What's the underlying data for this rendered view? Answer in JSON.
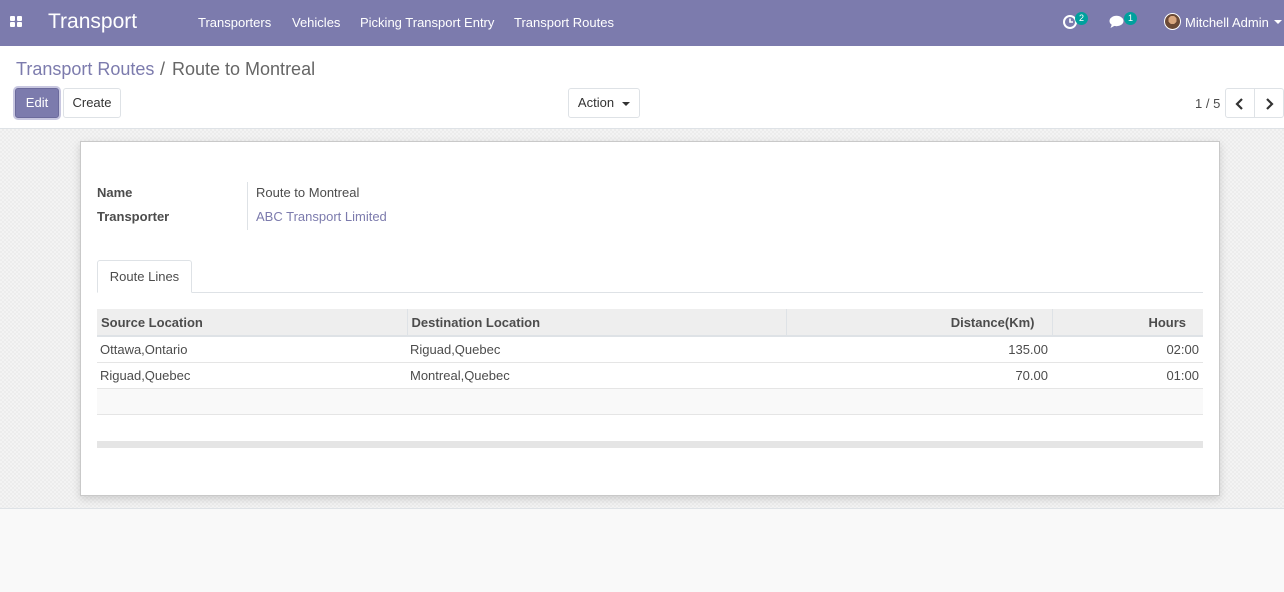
{
  "navbar": {
    "app_title": "Transport",
    "menu": [
      {
        "label": "Transporters"
      },
      {
        "label": "Vehicles"
      },
      {
        "label": "Picking Transport Entry"
      },
      {
        "label": "Transport Routes"
      }
    ],
    "activity_count": "2",
    "message_count": "1",
    "user_name": "Mitchell Admin",
    "icons": [
      "apps-grid-icon",
      "activity-clock-icon",
      "chat-bubbles-icon",
      "avatar"
    ],
    "accent_color": "#7c7bad"
  },
  "breadcrumb": {
    "parent": "Transport Routes",
    "separator": "/",
    "current": "Route to Montreal"
  },
  "toolbar": {
    "edit_label": "Edit",
    "create_label": "Create",
    "action_label": "Action"
  },
  "pager": {
    "value": "1 / 5"
  },
  "form": {
    "name_label": "Name",
    "name_value": "Route to Montreal",
    "transporter_label": "Transporter",
    "transporter_value": "ABC Transport Limited"
  },
  "tabs": [
    {
      "label": "Route Lines",
      "active": true
    }
  ],
  "route_lines": {
    "columns": {
      "source": "Source Location",
      "destination": "Destination Location",
      "distance": "Distance(Km)",
      "hours": "Hours"
    },
    "rows": [
      {
        "source": "Ottawa,Ontario",
        "destination": "Riguad,Quebec",
        "distance": "135.00",
        "hours": "02:00"
      },
      {
        "source": "Riguad,Quebec",
        "destination": "Montreal,Quebec",
        "distance": "70.00",
        "hours": "01:00"
      }
    ]
  }
}
